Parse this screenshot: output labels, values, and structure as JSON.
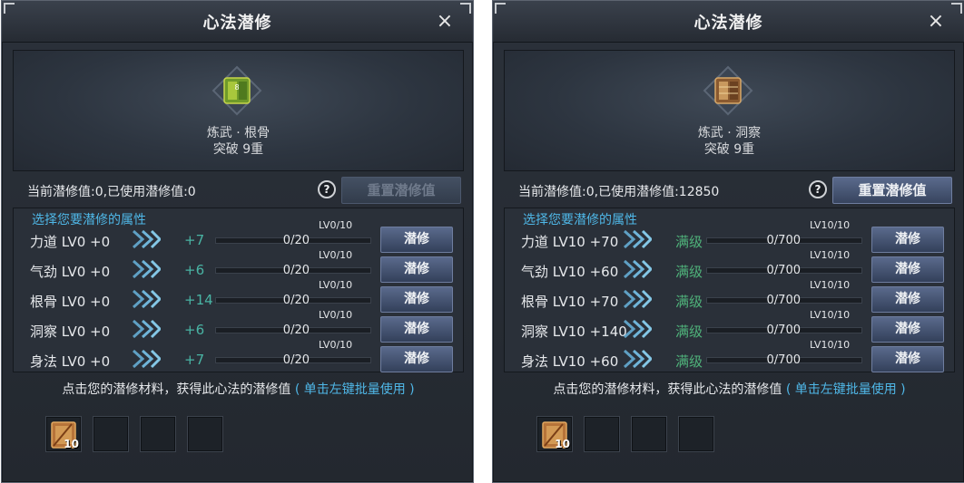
{
  "panels": [
    {
      "title": "心法潜修",
      "close": "×",
      "item": {
        "name": "炼武 · 根骨",
        "sub": "突破 9重",
        "icon": "green-book-icon"
      },
      "info": {
        "text": "当前潜修值:0,已使用潜修值:0",
        "help": "?",
        "reset_label": "重置潜修值",
        "reset_enabled": false
      },
      "prompt": "选择您要潜修的属性",
      "rows": [
        {
          "name": "力道 LV0 +0",
          "value": "+7",
          "count": "0/20",
          "level": "LV0/10",
          "button": "潜修",
          "progress": 0
        },
        {
          "name": "气劲 LV0 +0",
          "value": "+6",
          "count": "0/20",
          "level": "LV0/10",
          "button": "潜修",
          "progress": 0
        },
        {
          "name": "根骨 LV0 +0",
          "value": "+14",
          "count": "0/20",
          "level": "LV0/10",
          "button": "潜修",
          "progress": 0
        },
        {
          "name": "洞察 LV0 +0",
          "value": "+6",
          "count": "0/20",
          "level": "LV0/10",
          "button": "潜修",
          "progress": 0
        },
        {
          "name": "身法 LV0 +0",
          "value": "+7",
          "count": "0/20",
          "level": "LV0/10",
          "button": "潜修",
          "progress": 0
        }
      ],
      "hint": {
        "text": "点击您的潜修材料，获得此心法的潜修值",
        "link": "( 单击左键批量使用 )"
      },
      "slots": [
        {
          "qty": "10",
          "icon": "scroll-icon"
        },
        {
          "qty": ""
        },
        {
          "qty": ""
        },
        {
          "qty": ""
        }
      ]
    },
    {
      "title": "心法潜修",
      "close": "×",
      "item": {
        "name": "炼武 · 洞察",
        "sub": "突破 9重",
        "icon": "brown-book-icon"
      },
      "info": {
        "text": "当前潜修值:0,已使用潜修值:12850",
        "help": "?",
        "reset_label": "重置潜修值",
        "reset_enabled": true
      },
      "prompt": "选择您要潜修的属性",
      "rows": [
        {
          "name": "力道 LV10 +70",
          "value": "满级",
          "count": "0/700",
          "level": "LV10/10",
          "button": "潜修",
          "progress": 0
        },
        {
          "name": "气劲 LV10 +60",
          "value": "满级",
          "count": "0/700",
          "level": "LV10/10",
          "button": "潜修",
          "progress": 0
        },
        {
          "name": "根骨 LV10 +70",
          "value": "满级",
          "count": "0/700",
          "level": "LV10/10",
          "button": "潜修",
          "progress": 0
        },
        {
          "name": "洞察 LV10 +140",
          "value": "满级",
          "count": "0/700",
          "level": "LV10/10",
          "button": "潜修",
          "progress": 0
        },
        {
          "name": "身法 LV10 +60",
          "value": "满级",
          "count": "0/700",
          "level": "LV10/10",
          "button": "潜修",
          "progress": 0
        }
      ],
      "hint": {
        "text": "点击您的潜修材料，获得此心法的潜修值",
        "link": "( 单击左键批量使用 )"
      },
      "slots": [
        {
          "qty": "10",
          "icon": "scroll-icon"
        },
        {
          "qty": ""
        },
        {
          "qty": ""
        },
        {
          "qty": ""
        }
      ]
    }
  ],
  "colors": {
    "accent_blue": "#4fb7e7",
    "value_teal": "#49b4a4",
    "max_green": "#4fb27a"
  }
}
